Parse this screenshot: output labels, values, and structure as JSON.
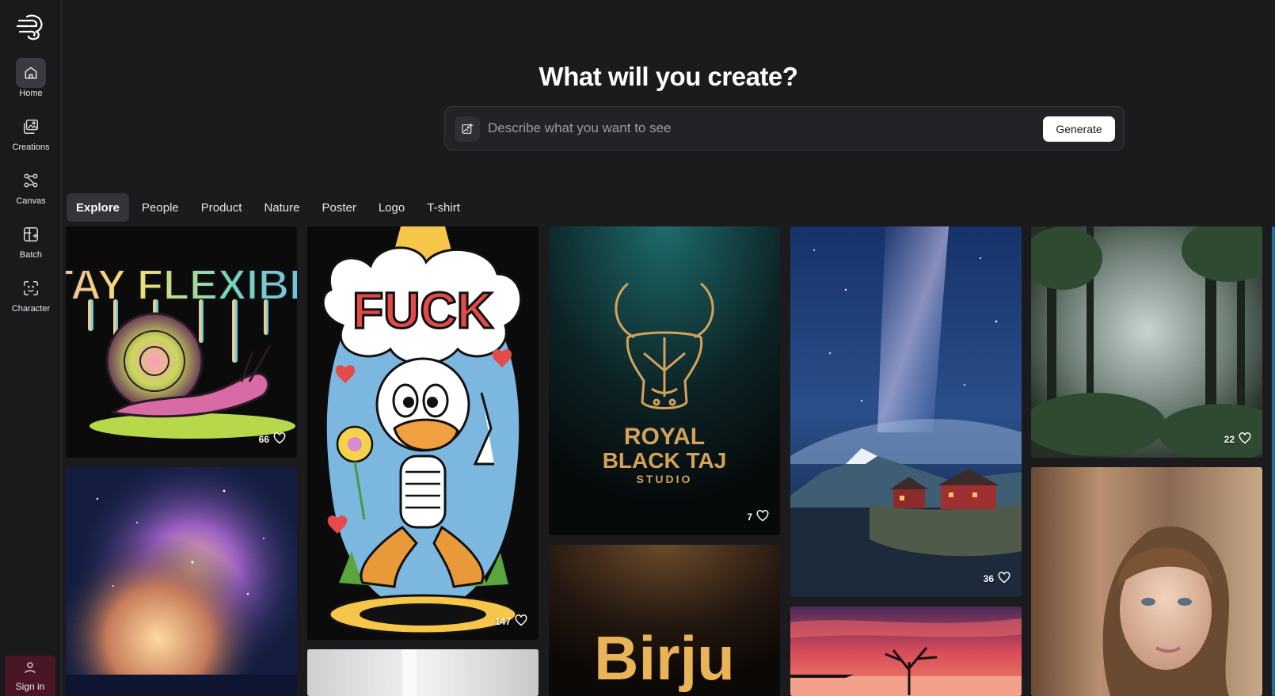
{
  "sidebar": {
    "items": [
      {
        "label": "Home",
        "icon": "home-icon",
        "active": true
      },
      {
        "label": "Creations",
        "icon": "image-stack-icon"
      },
      {
        "label": "Canvas",
        "icon": "canvas-nodes-icon"
      },
      {
        "label": "Batch",
        "icon": "batch-grid-icon"
      },
      {
        "label": "Character",
        "icon": "face-scan-icon"
      }
    ],
    "signin_label": "Sign in"
  },
  "hero": {
    "title": "What will you create?",
    "placeholder": "Describe what you want to see",
    "generate_label": "Generate"
  },
  "tabs": [
    "Explore",
    "People",
    "Product",
    "Nature",
    "Poster",
    "Logo",
    "T-shirt"
  ],
  "gallery": {
    "snail": {
      "artwork_text": "STAY FLEXIBLE",
      "likes": "66"
    },
    "duck": {
      "artwork_text": "FUCK",
      "likes": "147"
    },
    "bull": {
      "artwork_line1": "ROYAL",
      "artwork_line2": "BLACK TAJ",
      "artwork_line3": "STUDIO",
      "likes": "7"
    },
    "milkyway": {
      "likes": "36"
    },
    "forest": {
      "likes": "22"
    },
    "birju": {
      "artwork_text": "Birju"
    }
  },
  "colors": {
    "accent_signin": "#4a1626",
    "background": "#1b1b1e",
    "sidebar": "#1a1a1d"
  }
}
